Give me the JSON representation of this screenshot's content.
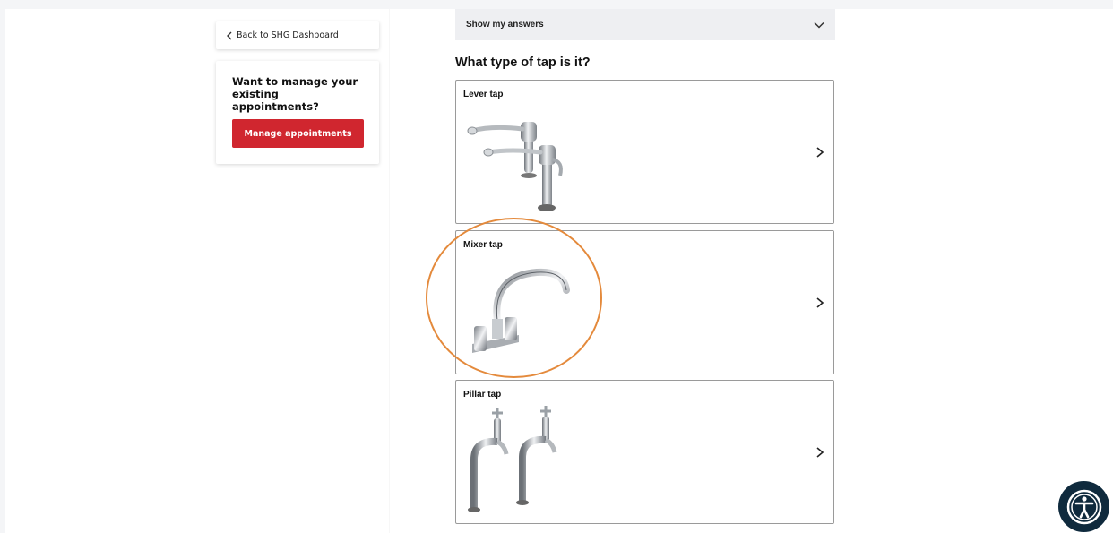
{
  "sidebar": {
    "back_label": "Back to SHG Dashboard",
    "manage_title": "Want to manage your existing appointments?",
    "manage_button": "Manage appointments"
  },
  "main": {
    "answers_toggle": "Show my answers",
    "question": "What type of tap is it?",
    "options": [
      {
        "label": "Lever tap",
        "image": "lever-tap-image"
      },
      {
        "label": "Mixer tap",
        "image": "mixer-tap-image"
      },
      {
        "label": "Pillar tap",
        "image": "pillar-tap-image"
      }
    ]
  },
  "colors": {
    "brand_red": "#d0262f",
    "highlight": "#e48a3c",
    "accessibility_bg": "#0f2a3d"
  },
  "icons": {
    "back": "chevron-left-icon",
    "toggle": "chevron-down-icon",
    "option_arrow": "chevron-right-icon",
    "accessibility": "accessibility-icon"
  }
}
